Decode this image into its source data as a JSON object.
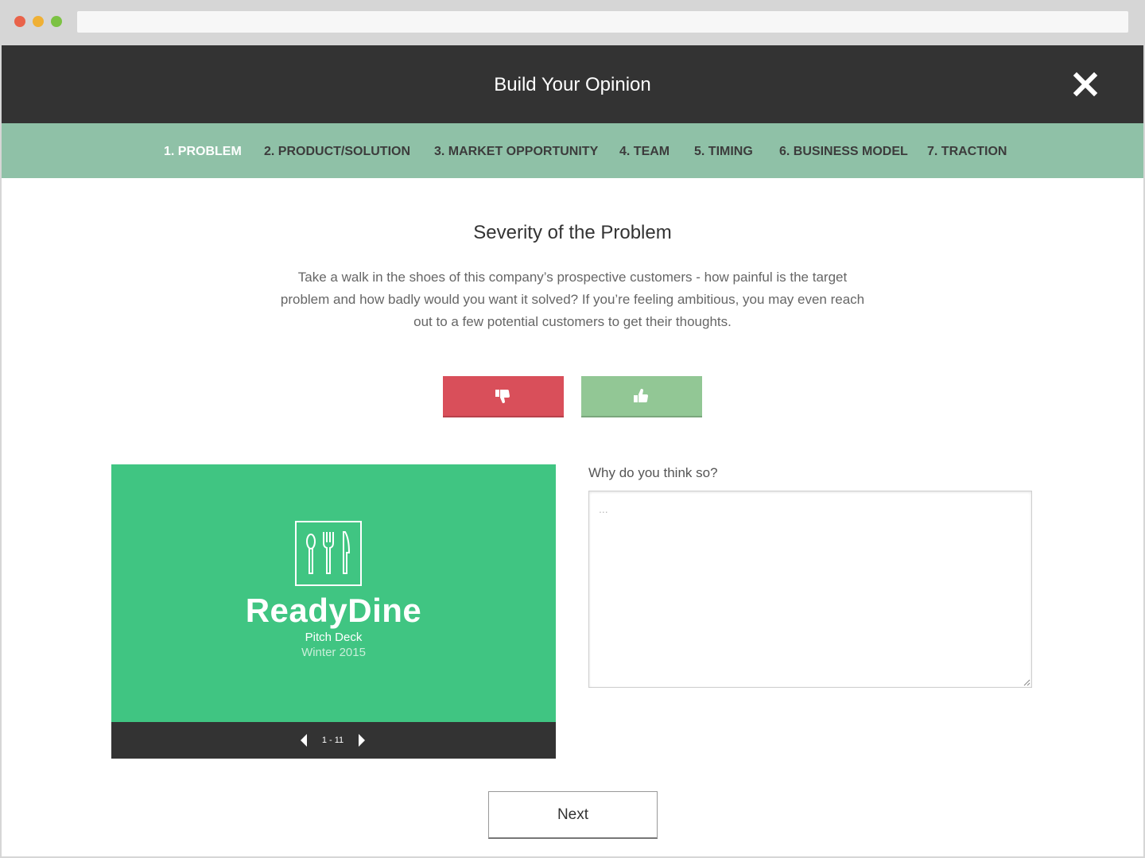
{
  "window": {
    "title": "Build Your Opinion"
  },
  "steps": [
    {
      "label": "1. PROBLEM",
      "active": true
    },
    {
      "label": "2. PRODUCT/SOLUTION",
      "active": false
    },
    {
      "label": "3. MARKET OPPORTUNITY",
      "active": false
    },
    {
      "label": "4. TEAM",
      "active": false
    },
    {
      "label": "5. TIMING",
      "active": false
    },
    {
      "label": "6. BUSINESS MODEL",
      "active": false
    },
    {
      "label": "7. TRACTION",
      "active": false
    }
  ],
  "question": {
    "title": "Severity of the Problem",
    "description": "Take a walk in the shoes of this company’s prospective customers - how painful is the target problem and how badly would you want it solved? If you’re feeling ambitious, you may even reach out to a few potential customers to get their thoughts."
  },
  "vote": {
    "down_icon": "thumbs-down-icon",
    "up_icon": "thumbs-up-icon",
    "down_color": "#d94f5a",
    "up_color": "#92c795"
  },
  "deck": {
    "brand": "ReadyDine",
    "subtitle": "Pitch Deck",
    "season": "Winter 2015",
    "page_indicator": "1 - 11",
    "slide_color": "#40c582",
    "logo_icon": "cutlery-icon"
  },
  "comment": {
    "label": "Why do you think so?",
    "placeholder": "...",
    "value": ""
  },
  "actions": {
    "next_label": "Next"
  },
  "colors": {
    "header_bg": "#333333",
    "steps_bg": "#8fc1a7"
  }
}
